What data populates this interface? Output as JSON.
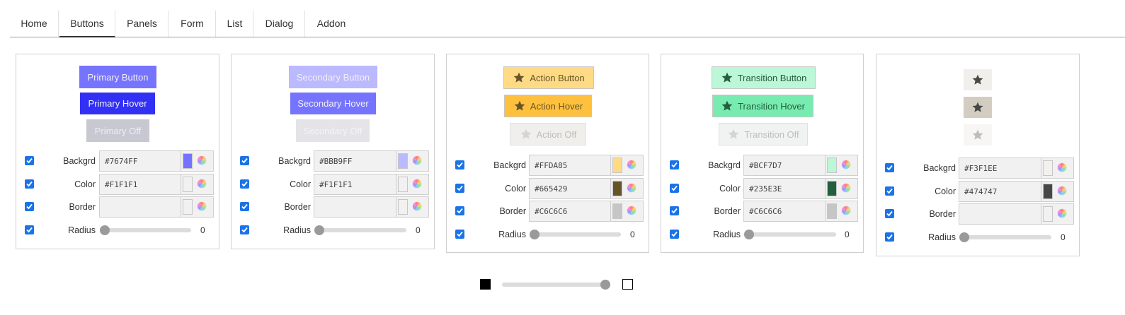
{
  "tabs": [
    "Home",
    "Buttons",
    "Panels",
    "Form",
    "List",
    "Dialog",
    "Addon"
  ],
  "active_tab": "Buttons",
  "labels": {
    "background": "Backgrd",
    "color": "Color",
    "border": "Border",
    "radius": "Radius"
  },
  "panels": [
    {
      "buttons": [
        "Primary Button",
        "Primary Hover",
        "Primary Off"
      ],
      "background": "#7674FF",
      "color": "#F1F1F1",
      "border": "",
      "radius": "0",
      "colors": {
        "button_bg": "#7674FF",
        "hover_bg": "#3330F5",
        "off_bg": "#C8C8D2",
        "off_text": "#EEEEF3",
        "text": "#F1F1F1"
      }
    },
    {
      "buttons": [
        "Secondary Button",
        "Secondary Hover",
        "Secondary Off"
      ],
      "background": "#BBB9FF",
      "color": "#F1F1F1",
      "border": "",
      "radius": "0",
      "colors": {
        "button_bg": "#BBB9FF",
        "hover_bg": "#7674FF",
        "off_bg": "#E4E4E8",
        "off_text": "#F4F4F6",
        "text": "#F1F1F1"
      }
    },
    {
      "buttons": [
        "Action Button",
        "Action Hover",
        "Action Off"
      ],
      "background": "#FFDA85",
      "color": "#665429",
      "border": "#C6C6C6",
      "radius": "0",
      "icons": "star-icon",
      "colors": {
        "button_bg": "#FFDA85",
        "hover_bg": "#FFC13D",
        "off_bg": "#F1EFEB",
        "off_text": "#BDBDBD",
        "text": "#665429"
      }
    },
    {
      "buttons": [
        "Transition Button",
        "Transition Hover",
        "Transition Off"
      ],
      "background": "#BCF7D7",
      "color": "#235E3E",
      "border": "#C6C6C6",
      "radius": "0",
      "icons": "star-icon",
      "colors": {
        "button_bg": "#BCF7D7",
        "hover_bg": "#78EBB1",
        "off_bg": "#F1F3F2",
        "off_text": "#BDBDBD",
        "text": "#235E3E"
      }
    },
    {
      "buttons": [],
      "background": "#F3F1EE",
      "color": "#474747",
      "border": "",
      "radius": "0",
      "icons": "star-icon",
      "colors": {
        "button_bg": "#F1EFEB",
        "hover_bg": "#D3CCC0",
        "off_bg": "#F7F6F4",
        "off_text": "#BDBDBD",
        "text": "#474747"
      }
    }
  ],
  "bottom_slider": {
    "value": 1
  }
}
